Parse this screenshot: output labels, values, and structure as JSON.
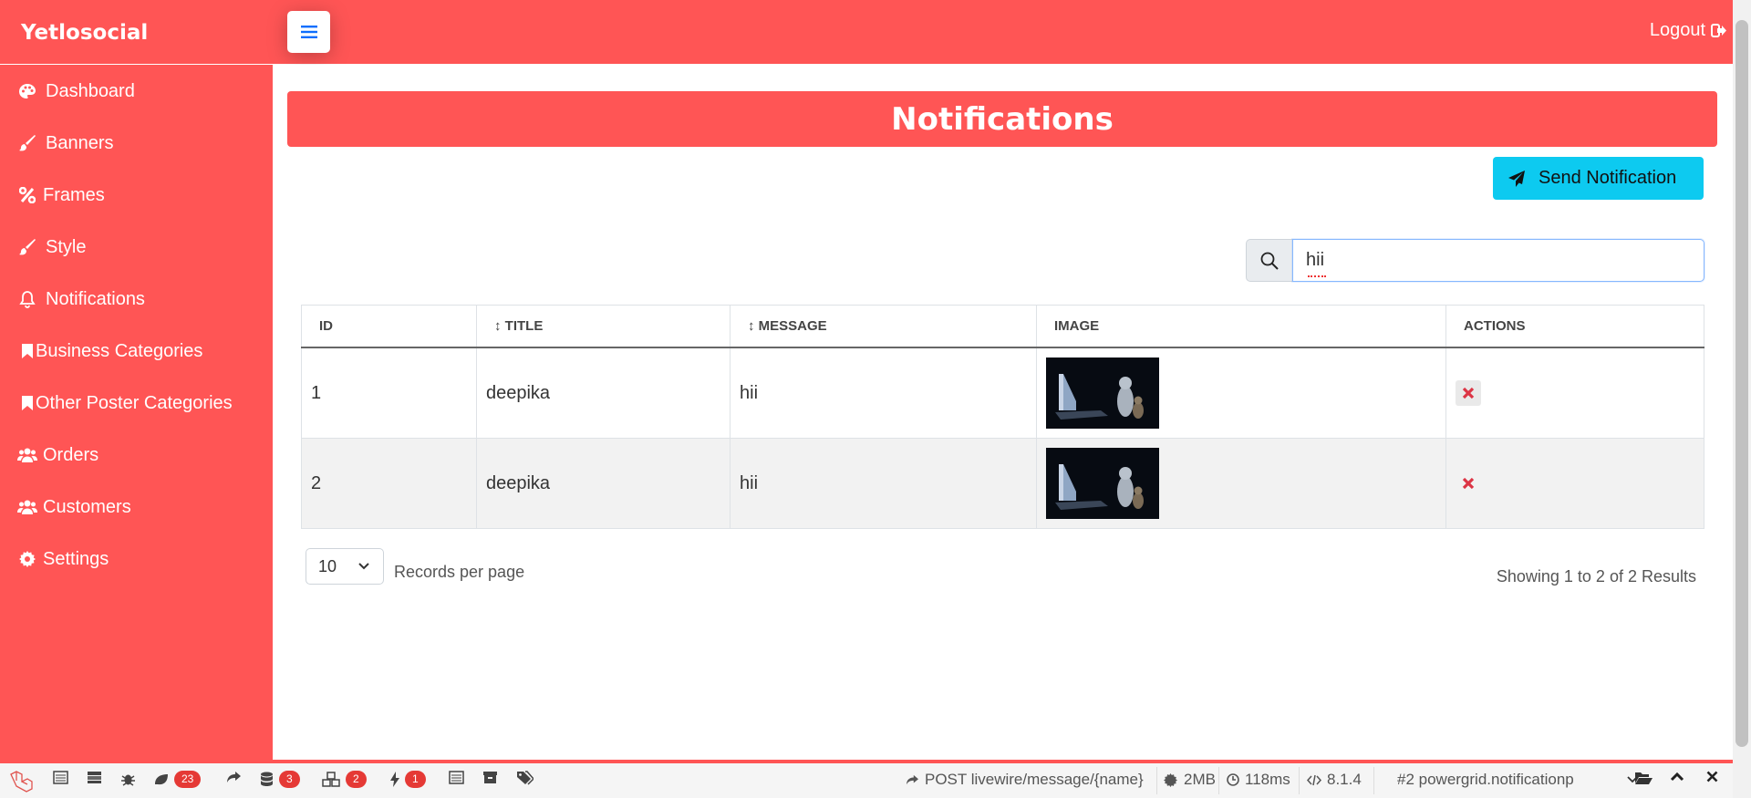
{
  "app": {
    "brand": "Yetlosocial",
    "logout_label": "Logout"
  },
  "sidebar": {
    "items": [
      {
        "label": "Dashboard",
        "icon": "palette-icon"
      },
      {
        "label": "Banners",
        "icon": "brush-icon"
      },
      {
        "label": "Frames",
        "icon": "percent-icon"
      },
      {
        "label": "Style",
        "icon": "brush-icon"
      },
      {
        "label": "Notifications",
        "icon": "bell-icon"
      },
      {
        "label": "Business Categories",
        "icon": "bookmark-icon"
      },
      {
        "label": "Other Poster Categories",
        "icon": "bookmark-icon"
      },
      {
        "label": "Orders",
        "icon": "users-icon"
      },
      {
        "label": "Customers",
        "icon": "users-icon"
      },
      {
        "label": "Settings",
        "icon": "gear-icon"
      }
    ]
  },
  "page": {
    "title": "Notifications",
    "send_label": "Send Notification"
  },
  "search": {
    "value": "hii"
  },
  "table": {
    "headers": {
      "id": "ID",
      "title": "↕ TITLE",
      "message": "↕ MESSAGE",
      "image": "IMAGE",
      "actions": "ACTIONS"
    },
    "rows": [
      {
        "id": "1",
        "title": "deepika",
        "message": "hii",
        "image": "cat-with-laptop-thumbnail"
      },
      {
        "id": "2",
        "title": "deepika",
        "message": "hii",
        "image": "cat-with-laptop-thumbnail"
      }
    ]
  },
  "pagination": {
    "per_page": "10",
    "records_label": "Records per page",
    "summary": "Showing 1 to 2 of 2 Results"
  },
  "debugbar": {
    "badge_models": "23",
    "badge_queries": "3",
    "badge_livewire": "2",
    "badge_events": "1",
    "request": "POST livewire/message/{name}",
    "memory": "2MB",
    "time": "118ms",
    "php": "8.1.4",
    "history": "#2 powergrid.notificationp"
  },
  "colors": {
    "primary": "#ff5555",
    "info": "#0dcaf0",
    "danger": "#dc3545"
  }
}
